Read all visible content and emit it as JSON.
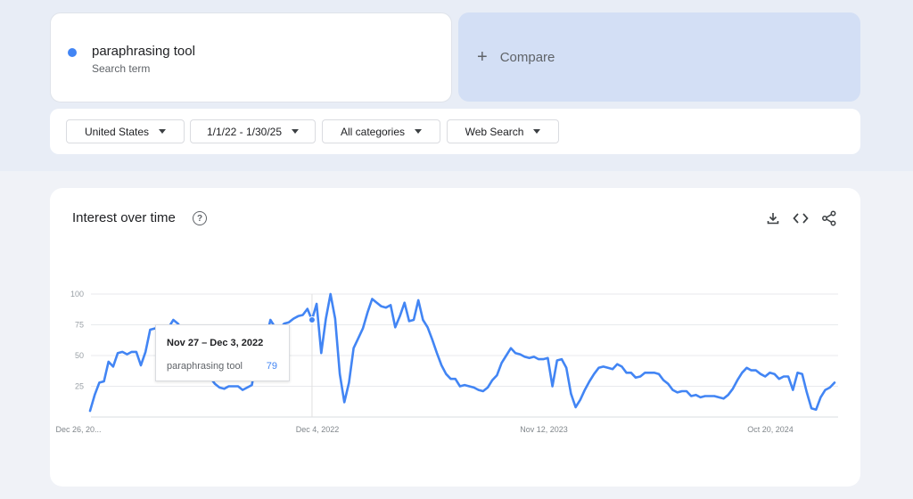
{
  "search_term": {
    "name": "paraphrasing tool",
    "sublabel": "Search term",
    "color": "#4285f4"
  },
  "compare": {
    "plus": "+",
    "label": "Compare"
  },
  "filters": {
    "region": "United States",
    "date_range": "1/1/22 - 1/30/25",
    "category": "All categories",
    "search_type": "Web Search"
  },
  "panel": {
    "title": "Interest over time",
    "help_glyph": "?",
    "icons": [
      "download-icon",
      "embed-code-icon",
      "share-icon"
    ]
  },
  "tooltip": {
    "date": "Nov 27 – Dec 3, 2022",
    "term": "paraphrasing tool",
    "value": "79"
  },
  "chart_data": {
    "type": "line",
    "ylim": [
      0,
      100
    ],
    "y_ticks": [
      "25",
      "50",
      "75",
      "100"
    ],
    "x_tick_labels": [
      "Dec 26, 20...",
      "Dec 4, 2022",
      "Nov 12, 2023",
      "Oct 20, 2024"
    ],
    "highlight_index": 48,
    "grid": true,
    "series": [
      {
        "color": "#4285f4",
        "values": [
          5,
          18,
          28,
          29,
          45,
          41,
          52,
          53,
          51,
          53,
          53,
          42,
          53,
          71,
          72,
          73,
          62,
          73,
          79,
          76,
          71,
          60,
          52,
          44,
          37,
          36,
          32,
          27,
          24,
          23,
          25,
          25,
          25,
          22,
          24,
          26,
          47,
          55,
          63,
          79,
          73,
          72,
          76,
          77,
          80,
          82,
          83,
          88,
          79,
          92,
          52,
          80,
          100,
          80,
          35,
          12,
          28,
          56,
          64,
          72,
          85,
          96,
          93,
          90,
          89,
          91,
          73,
          82,
          93,
          78,
          79,
          95,
          79,
          73,
          63,
          52,
          42,
          35,
          31,
          31,
          25,
          26,
          25,
          24,
          22,
          21,
          24,
          30,
          34,
          44,
          50,
          56,
          52,
          51,
          49,
          48,
          49,
          47,
          47,
          48,
          25,
          46,
          47,
          40,
          19,
          8,
          14,
          22,
          29,
          35,
          40,
          41,
          40,
          39,
          43,
          41,
          36,
          36,
          32,
          33,
          36,
          36,
          36,
          35,
          30,
          27,
          22,
          20,
          21,
          21,
          17,
          18,
          16,
          17,
          17,
          17,
          16,
          15,
          18,
          23,
          30,
          36,
          40,
          38,
          38,
          35,
          33,
          36,
          35,
          31,
          33,
          33,
          22,
          36,
          35,
          20,
          7,
          6,
          16,
          22,
          24,
          28
        ]
      }
    ]
  }
}
